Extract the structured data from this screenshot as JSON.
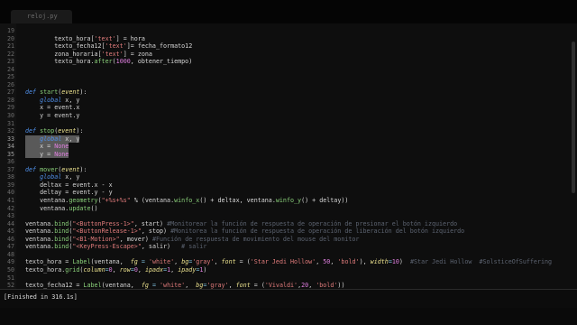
{
  "tab": {
    "label": "reloj.py"
  },
  "output": {
    "text": "[Finished in 316.1s]"
  },
  "colors": {
    "background": "#0e0e0e",
    "keyword": "#4f8fe8",
    "function": "#8ad07a",
    "string": "#e07b7b",
    "comment": "#5c6370",
    "selection": "#595959"
  },
  "lines": [
    {
      "num": "19",
      "hl": false,
      "tokens": []
    },
    {
      "num": "20",
      "hl": false,
      "tokens": [
        [
          "        texto_hora[",
          ""
        ],
        [
          "'text'",
          "s"
        ],
        [
          "] = hora",
          ""
        ]
      ]
    },
    {
      "num": "21",
      "hl": false,
      "tokens": [
        [
          "        texto_fecha12[",
          ""
        ],
        [
          "'text'",
          "s"
        ],
        [
          "]= fecha_formato12",
          ""
        ]
      ]
    },
    {
      "num": "22",
      "hl": false,
      "tokens": [
        [
          "        zona_horaria[",
          ""
        ],
        [
          "'text'",
          "s"
        ],
        [
          "] = zona",
          ""
        ]
      ]
    },
    {
      "num": "23",
      "hl": false,
      "tokens": [
        [
          "        texto_hora.",
          ""
        ],
        [
          "after",
          "f"
        ],
        [
          "(",
          ""
        ],
        [
          "1000",
          "m"
        ],
        [
          ", obtener_tiempo)",
          ""
        ]
      ]
    },
    {
      "num": "24",
      "hl": false,
      "tokens": []
    },
    {
      "num": "25",
      "hl": false,
      "tokens": []
    },
    {
      "num": "26",
      "hl": false,
      "tokens": []
    },
    {
      "num": "27",
      "hl": false,
      "tokens": [
        [
          "def ",
          "k"
        ],
        [
          "start",
          "f"
        ],
        [
          "(",
          ""
        ],
        [
          "event",
          "p"
        ],
        [
          "):",
          ""
        ]
      ]
    },
    {
      "num": "28",
      "hl": false,
      "tokens": [
        [
          "    ",
          ""
        ],
        [
          "global",
          "k"
        ],
        [
          " x, y",
          ""
        ]
      ]
    },
    {
      "num": "29",
      "hl": false,
      "tokens": [
        [
          "    x = event.x",
          ""
        ]
      ]
    },
    {
      "num": "30",
      "hl": false,
      "tokens": [
        [
          "    y = event.y",
          ""
        ]
      ]
    },
    {
      "num": "31",
      "hl": false,
      "tokens": []
    },
    {
      "num": "32",
      "hl": false,
      "tokens": [
        [
          "def ",
          "k"
        ],
        [
          "stop",
          "f"
        ],
        [
          "(",
          ""
        ],
        [
          "event",
          "p"
        ],
        [
          "):",
          ""
        ]
      ]
    },
    {
      "num": "33",
      "hl": true,
      "tokens": [
        [
          "    ",
          ""
        ],
        [
          "global",
          "k"
        ],
        [
          " x, y",
          ""
        ]
      ]
    },
    {
      "num": "34",
      "hl": true,
      "tokens": [
        [
          "    x = ",
          ""
        ],
        [
          "None",
          "m"
        ]
      ]
    },
    {
      "num": "35",
      "hl": true,
      "tokens": [
        [
          "    y = ",
          ""
        ],
        [
          "None",
          "m"
        ]
      ]
    },
    {
      "num": "36",
      "hl": false,
      "tokens": []
    },
    {
      "num": "37",
      "hl": false,
      "tokens": [
        [
          "def ",
          "k"
        ],
        [
          "mover",
          "f"
        ],
        [
          "(",
          ""
        ],
        [
          "event",
          "p"
        ],
        [
          "):",
          ""
        ]
      ]
    },
    {
      "num": "38",
      "hl": false,
      "tokens": [
        [
          "    ",
          ""
        ],
        [
          "global",
          "k"
        ],
        [
          " x, y",
          ""
        ]
      ]
    },
    {
      "num": "39",
      "hl": false,
      "tokens": [
        [
          "    deltax = event.x - x",
          ""
        ]
      ]
    },
    {
      "num": "40",
      "hl": false,
      "tokens": [
        [
          "    deltay = event.y - y",
          ""
        ]
      ]
    },
    {
      "num": "41",
      "hl": false,
      "tokens": [
        [
          "    ventana.",
          ""
        ],
        [
          "geometry",
          "f"
        ],
        [
          "(",
          ""
        ],
        [
          "\"+%s+%s\"",
          "s"
        ],
        [
          " % (ventana.",
          ""
        ],
        [
          "winfo_x",
          "f"
        ],
        [
          "() + deltax, ventana.",
          ""
        ],
        [
          "winfo_y",
          "f"
        ],
        [
          "() + deltay))",
          ""
        ]
      ]
    },
    {
      "num": "42",
      "hl": false,
      "tokens": [
        [
          "    ventana.",
          ""
        ],
        [
          "update",
          "f"
        ],
        [
          "()",
          ""
        ]
      ]
    },
    {
      "num": "43",
      "hl": false,
      "tokens": []
    },
    {
      "num": "44",
      "hl": false,
      "tokens": [
        [
          "ventana.",
          ""
        ],
        [
          "bind",
          "f"
        ],
        [
          "(",
          ""
        ],
        [
          "\"<ButtonPress-1>\"",
          "s"
        ],
        [
          ", start) ",
          ""
        ],
        [
          "#Monitorear la función de respuesta de operación de presionar el botón izquierdo",
          "c"
        ]
      ]
    },
    {
      "num": "45",
      "hl": false,
      "tokens": [
        [
          "ventana.",
          ""
        ],
        [
          "bind",
          "f"
        ],
        [
          "(",
          ""
        ],
        [
          "\"<ButtonRelease-1>\"",
          "s"
        ],
        [
          ", stop) ",
          ""
        ],
        [
          "#Monitorea la función de respuesta de operación de liberación del botón izquierdo",
          "c"
        ]
      ]
    },
    {
      "num": "46",
      "hl": false,
      "tokens": [
        [
          "ventana.",
          ""
        ],
        [
          "bind",
          "f"
        ],
        [
          "(",
          ""
        ],
        [
          "\"<B1-Motion>\"",
          "s"
        ],
        [
          ", mover) ",
          ""
        ],
        [
          "#Función de respuesta de movimiento del mouse del monitor",
          "c"
        ]
      ]
    },
    {
      "num": "47",
      "hl": false,
      "tokens": [
        [
          "ventana.",
          ""
        ],
        [
          "bind",
          "f"
        ],
        [
          "(",
          ""
        ],
        [
          "\"<KeyPress-Escape>\"",
          "s"
        ],
        [
          ", salir)   ",
          ""
        ],
        [
          "# salir",
          "c"
        ]
      ]
    },
    {
      "num": "48",
      "hl": false,
      "tokens": []
    },
    {
      "num": "49",
      "hl": false,
      "tokens": [
        [
          "texto_hora = ",
          ""
        ],
        [
          "Label",
          "f"
        ],
        [
          "(ventana,  ",
          ""
        ],
        [
          "fg",
          "p"
        ],
        [
          " = ",
          "o"
        ],
        [
          "'white'",
          "s"
        ],
        [
          ", ",
          ""
        ],
        [
          "bg",
          "p"
        ],
        [
          "=",
          "o"
        ],
        [
          "'gray'",
          "s"
        ],
        [
          ", ",
          ""
        ],
        [
          "font",
          "p"
        ],
        [
          " = (",
          ""
        ],
        [
          "'Star Jedi Hollow'",
          "s"
        ],
        [
          ", ",
          ""
        ],
        [
          "50",
          "m"
        ],
        [
          ", ",
          ""
        ],
        [
          "'bold'",
          "s"
        ],
        [
          "), ",
          ""
        ],
        [
          "width",
          "p"
        ],
        [
          "=",
          "o"
        ],
        [
          "10",
          "m"
        ],
        [
          ")  ",
          ""
        ],
        [
          "#Star Jedi Hollow  #SolsticeOfSuffering",
          "c"
        ]
      ]
    },
    {
      "num": "50",
      "hl": false,
      "tokens": [
        [
          "texto_hora.",
          ""
        ],
        [
          "grid",
          "f"
        ],
        [
          "(",
          ""
        ],
        [
          "column",
          "p"
        ],
        [
          "=",
          "o"
        ],
        [
          "0",
          "m"
        ],
        [
          ", ",
          ""
        ],
        [
          "row",
          "p"
        ],
        [
          "=",
          "o"
        ],
        [
          "0",
          "m"
        ],
        [
          ", ",
          ""
        ],
        [
          "ipadx",
          "p"
        ],
        [
          "=",
          "o"
        ],
        [
          "1",
          "m"
        ],
        [
          ", ",
          ""
        ],
        [
          "ipady",
          "p"
        ],
        [
          "=",
          "o"
        ],
        [
          "1",
          "m"
        ],
        [
          ")",
          ""
        ]
      ]
    },
    {
      "num": "51",
      "hl": false,
      "tokens": []
    },
    {
      "num": "52",
      "hl": false,
      "tokens": [
        [
          "texto_fecha12 = ",
          ""
        ],
        [
          "Label",
          "f"
        ],
        [
          "(ventana,  ",
          ""
        ],
        [
          "fg",
          "p"
        ],
        [
          " = ",
          "o"
        ],
        [
          "'white'",
          "s"
        ],
        [
          ",  ",
          ""
        ],
        [
          "bg",
          "p"
        ],
        [
          "=",
          "o"
        ],
        [
          "'gray'",
          "s"
        ],
        [
          ", ",
          ""
        ],
        [
          "font",
          "p"
        ],
        [
          " = (",
          ""
        ],
        [
          "'Vivaldi'",
          "s"
        ],
        [
          ",",
          ""
        ],
        [
          "20",
          "m"
        ],
        [
          ", ",
          ""
        ],
        [
          "'bold'",
          "s"
        ],
        [
          "))",
          ""
        ]
      ]
    },
    {
      "num": "53",
      "hl": false,
      "tokens": [
        [
          "texto_fecha12.",
          ""
        ],
        [
          "grid",
          "f"
        ],
        [
          "(",
          ""
        ],
        [
          "column",
          "p"
        ],
        [
          "= ",
          "o"
        ],
        [
          "0",
          "m"
        ],
        [
          ", ",
          ""
        ],
        [
          "row",
          "p"
        ],
        [
          "=",
          "o"
        ],
        [
          "1",
          "m"
        ],
        [
          ")",
          ""
        ]
      ]
    }
  ]
}
